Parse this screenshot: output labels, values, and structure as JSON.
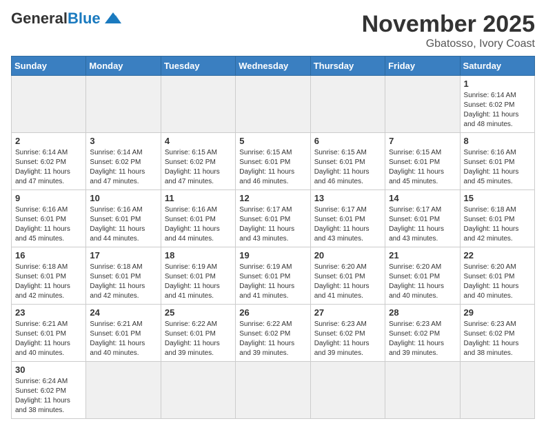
{
  "header": {
    "logo_general": "General",
    "logo_blue": "Blue",
    "month_title": "November 2025",
    "location": "Gbatosso, Ivory Coast"
  },
  "weekdays": [
    "Sunday",
    "Monday",
    "Tuesday",
    "Wednesday",
    "Thursday",
    "Friday",
    "Saturday"
  ],
  "weeks": [
    [
      {
        "day": "",
        "info": ""
      },
      {
        "day": "",
        "info": ""
      },
      {
        "day": "",
        "info": ""
      },
      {
        "day": "",
        "info": ""
      },
      {
        "day": "",
        "info": ""
      },
      {
        "day": "",
        "info": ""
      },
      {
        "day": "1",
        "info": "Sunrise: 6:14 AM\nSunset: 6:02 PM\nDaylight: 11 hours\nand 48 minutes."
      }
    ],
    [
      {
        "day": "2",
        "info": "Sunrise: 6:14 AM\nSunset: 6:02 PM\nDaylight: 11 hours\nand 47 minutes."
      },
      {
        "day": "3",
        "info": "Sunrise: 6:14 AM\nSunset: 6:02 PM\nDaylight: 11 hours\nand 47 minutes."
      },
      {
        "day": "4",
        "info": "Sunrise: 6:15 AM\nSunset: 6:02 PM\nDaylight: 11 hours\nand 47 minutes."
      },
      {
        "day": "5",
        "info": "Sunrise: 6:15 AM\nSunset: 6:01 PM\nDaylight: 11 hours\nand 46 minutes."
      },
      {
        "day": "6",
        "info": "Sunrise: 6:15 AM\nSunset: 6:01 PM\nDaylight: 11 hours\nand 46 minutes."
      },
      {
        "day": "7",
        "info": "Sunrise: 6:15 AM\nSunset: 6:01 PM\nDaylight: 11 hours\nand 45 minutes."
      },
      {
        "day": "8",
        "info": "Sunrise: 6:16 AM\nSunset: 6:01 PM\nDaylight: 11 hours\nand 45 minutes."
      }
    ],
    [
      {
        "day": "9",
        "info": "Sunrise: 6:16 AM\nSunset: 6:01 PM\nDaylight: 11 hours\nand 45 minutes."
      },
      {
        "day": "10",
        "info": "Sunrise: 6:16 AM\nSunset: 6:01 PM\nDaylight: 11 hours\nand 44 minutes."
      },
      {
        "day": "11",
        "info": "Sunrise: 6:16 AM\nSunset: 6:01 PM\nDaylight: 11 hours\nand 44 minutes."
      },
      {
        "day": "12",
        "info": "Sunrise: 6:17 AM\nSunset: 6:01 PM\nDaylight: 11 hours\nand 43 minutes."
      },
      {
        "day": "13",
        "info": "Sunrise: 6:17 AM\nSunset: 6:01 PM\nDaylight: 11 hours\nand 43 minutes."
      },
      {
        "day": "14",
        "info": "Sunrise: 6:17 AM\nSunset: 6:01 PM\nDaylight: 11 hours\nand 43 minutes."
      },
      {
        "day": "15",
        "info": "Sunrise: 6:18 AM\nSunset: 6:01 PM\nDaylight: 11 hours\nand 42 minutes."
      }
    ],
    [
      {
        "day": "16",
        "info": "Sunrise: 6:18 AM\nSunset: 6:01 PM\nDaylight: 11 hours\nand 42 minutes."
      },
      {
        "day": "17",
        "info": "Sunrise: 6:18 AM\nSunset: 6:01 PM\nDaylight: 11 hours\nand 42 minutes."
      },
      {
        "day": "18",
        "info": "Sunrise: 6:19 AM\nSunset: 6:01 PM\nDaylight: 11 hours\nand 41 minutes."
      },
      {
        "day": "19",
        "info": "Sunrise: 6:19 AM\nSunset: 6:01 PM\nDaylight: 11 hours\nand 41 minutes."
      },
      {
        "day": "20",
        "info": "Sunrise: 6:20 AM\nSunset: 6:01 PM\nDaylight: 11 hours\nand 41 minutes."
      },
      {
        "day": "21",
        "info": "Sunrise: 6:20 AM\nSunset: 6:01 PM\nDaylight: 11 hours\nand 40 minutes."
      },
      {
        "day": "22",
        "info": "Sunrise: 6:20 AM\nSunset: 6:01 PM\nDaylight: 11 hours\nand 40 minutes."
      }
    ],
    [
      {
        "day": "23",
        "info": "Sunrise: 6:21 AM\nSunset: 6:01 PM\nDaylight: 11 hours\nand 40 minutes."
      },
      {
        "day": "24",
        "info": "Sunrise: 6:21 AM\nSunset: 6:01 PM\nDaylight: 11 hours\nand 40 minutes."
      },
      {
        "day": "25",
        "info": "Sunrise: 6:22 AM\nSunset: 6:01 PM\nDaylight: 11 hours\nand 39 minutes."
      },
      {
        "day": "26",
        "info": "Sunrise: 6:22 AM\nSunset: 6:02 PM\nDaylight: 11 hours\nand 39 minutes."
      },
      {
        "day": "27",
        "info": "Sunrise: 6:23 AM\nSunset: 6:02 PM\nDaylight: 11 hours\nand 39 minutes."
      },
      {
        "day": "28",
        "info": "Sunrise: 6:23 AM\nSunset: 6:02 PM\nDaylight: 11 hours\nand 39 minutes."
      },
      {
        "day": "29",
        "info": "Sunrise: 6:23 AM\nSunset: 6:02 PM\nDaylight: 11 hours\nand 38 minutes."
      }
    ],
    [
      {
        "day": "30",
        "info": "Sunrise: 6:24 AM\nSunset: 6:02 PM\nDaylight: 11 hours\nand 38 minutes."
      },
      {
        "day": "",
        "info": ""
      },
      {
        "day": "",
        "info": ""
      },
      {
        "day": "",
        "info": ""
      },
      {
        "day": "",
        "info": ""
      },
      {
        "day": "",
        "info": ""
      },
      {
        "day": "",
        "info": ""
      }
    ]
  ]
}
